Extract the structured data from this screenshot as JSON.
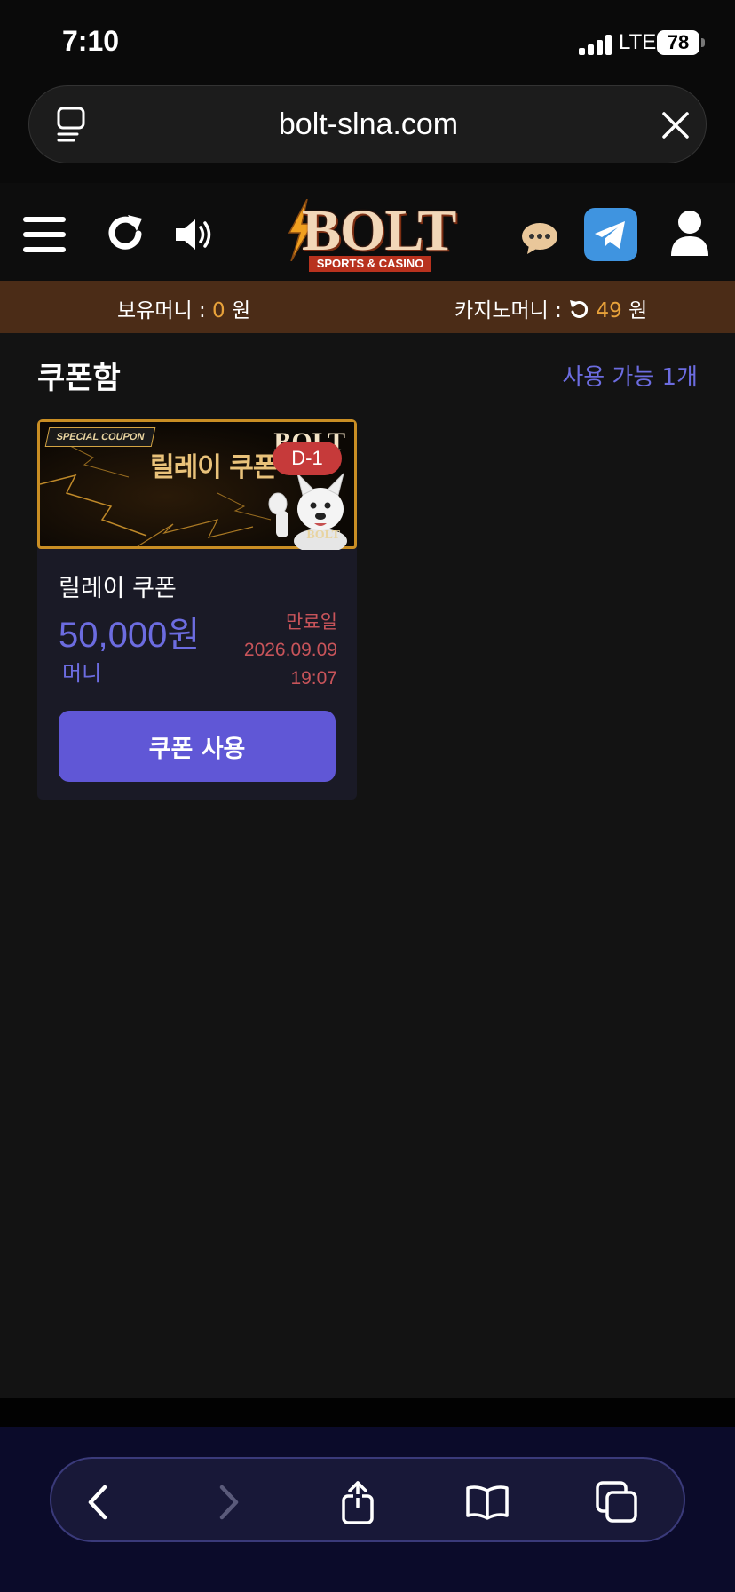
{
  "status_bar": {
    "time": "7:10",
    "network": "LTE",
    "battery": "78"
  },
  "browser": {
    "url": "bolt-slna.com"
  },
  "header": {
    "logo_text": "BOLT",
    "logo_sub": "SPORTS & CASINO"
  },
  "money_bar": {
    "holding_label": "보유머니 : ",
    "holding_value": "0",
    "holding_unit": " 원",
    "casino_label": "카지노머니 : ",
    "casino_value": "49",
    "casino_unit": " 원"
  },
  "coupon_box": {
    "title": "쿠폰함",
    "available": "사용 가능 1개"
  },
  "coupon": {
    "banner_tag": "SPECIAL COUPON",
    "banner_title": "릴레이 쿠폰",
    "banner_brand": "BOLT",
    "banner_brand_small": "BOLT",
    "dday": "D-1",
    "name": "릴레이 쿠폰",
    "amount": "50,000원",
    "type": "머니",
    "expiry_label": "만료일",
    "expiry_date": "2026.09.09",
    "expiry_time": "19:07",
    "button_label": "쿠폰 사용"
  },
  "colors": {
    "accent": "#6057d6",
    "money": "#e8a23a",
    "expiry": "#c8545a",
    "money_bar": "#4b2c17"
  },
  "icons": [
    "menu-icon",
    "refresh-icon",
    "speaker-icon",
    "chat-icon",
    "telegram-icon",
    "user-icon",
    "back-icon",
    "forward-icon",
    "share-icon",
    "bookmarks-icon",
    "tabs-icon"
  ]
}
